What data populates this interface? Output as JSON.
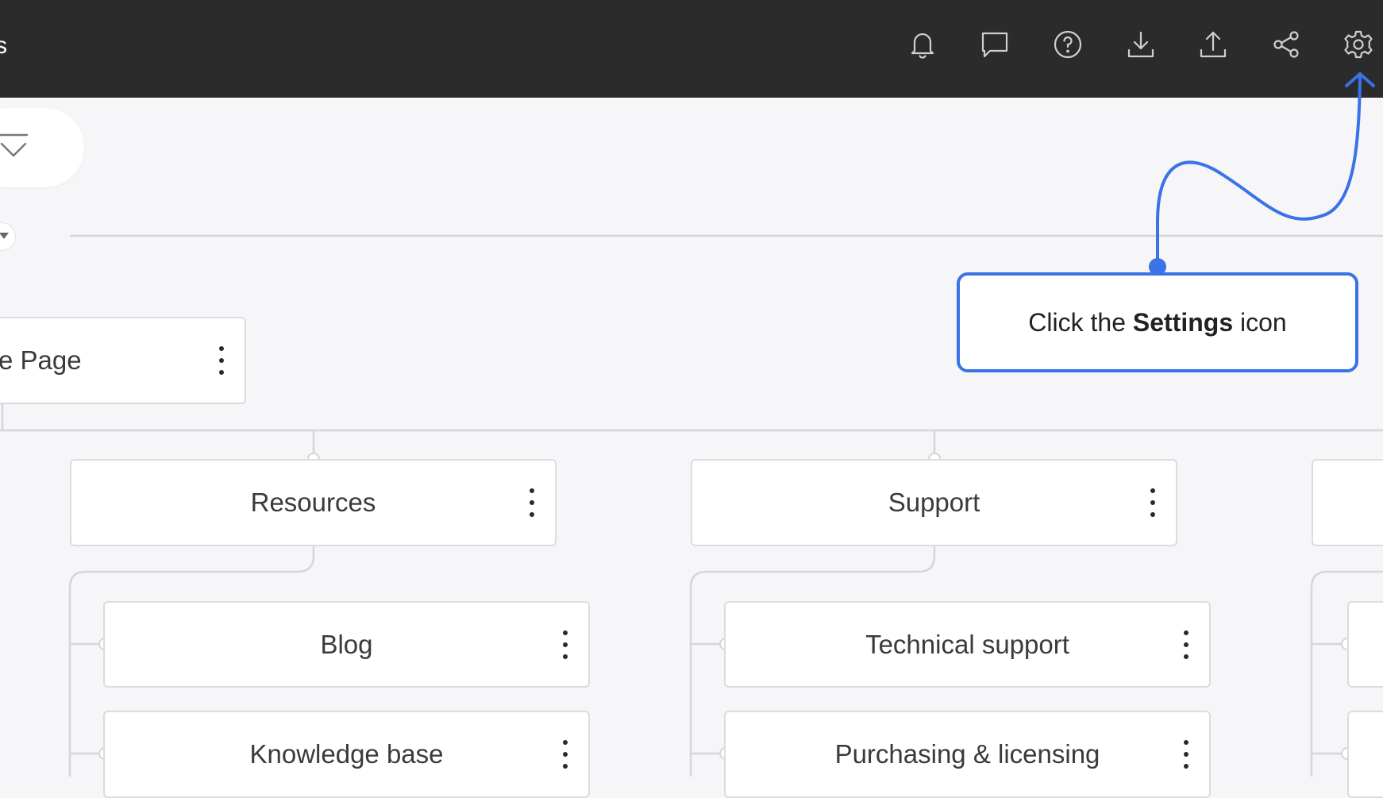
{
  "header": {
    "title_fragment": "s",
    "icons": [
      {
        "name": "bell-icon"
      },
      {
        "name": "comment-icon"
      },
      {
        "name": "help-icon"
      },
      {
        "name": "download-icon"
      },
      {
        "name": "upload-icon"
      },
      {
        "name": "share-icon"
      },
      {
        "name": "settings-icon"
      }
    ]
  },
  "toolbar": {
    "collapse_icon": "collapse-all-icon"
  },
  "sitemap": {
    "root": {
      "label": "e Page"
    },
    "columns": [
      {
        "label": "Resources",
        "children": [
          {
            "label": "Blog"
          },
          {
            "label": "Knowledge base"
          }
        ]
      },
      {
        "label": "Support",
        "children": [
          {
            "label": "Technical support"
          },
          {
            "label": "Purchasing & licensing"
          }
        ]
      }
    ]
  },
  "callout": {
    "prefix": "Click the ",
    "bold": "Settings",
    "suffix": " icon"
  },
  "colors": {
    "topbar": "#2b2b2b",
    "accent": "#3a72e8",
    "canvas": "#f6f6f8",
    "connector": "#d6d6da"
  }
}
